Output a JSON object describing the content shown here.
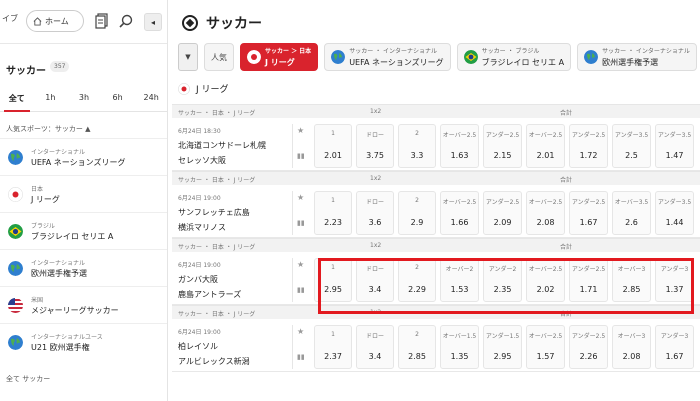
{
  "topbar": {
    "ibu_label": "イブ",
    "home_label": "ホーム",
    "collapse_glyph": "◂"
  },
  "sidebar": {
    "title": "サッカー",
    "count": "357",
    "time_tabs": [
      "全て",
      "1h",
      "3h",
      "6h",
      "24h"
    ],
    "popular_heading": "人気スポーツ：サッカー ▲",
    "items": [
      {
        "sub": "インターナショナル",
        "name": "UEFA ネーションズリーグ",
        "flag": "globe"
      },
      {
        "sub": "日本",
        "name": "J リーグ",
        "flag": "japan"
      },
      {
        "sub": "ブラジル",
        "name": "ブラジレイロ セリエ A",
        "flag": "brazil"
      },
      {
        "sub": "インターナショナル",
        "name": "欧州選手権予選",
        "flag": "globe"
      },
      {
        "sub": "米国",
        "name": "メジャーリーグサッカー",
        "flag": "usa"
      },
      {
        "sub": "インターナショナルユース",
        "name": "U21 欧州選手権",
        "flag": "globe"
      }
    ],
    "all_label": "全て サッカー"
  },
  "main": {
    "title": "サッカー",
    "chips": [
      {
        "plain": "人気"
      },
      {
        "sub": "サッカー ＞ 日本",
        "name": "J リーグ",
        "active": true,
        "flag": "japan"
      },
      {
        "sub": "サッカー ・ インターナショナル",
        "name": "UEFA ネーションズリーグ",
        "flag": "globe"
      },
      {
        "sub": "サッカー ・ ブラジル",
        "name": "ブラジレイロ セリエ A",
        "flag": "brazil"
      },
      {
        "sub": "サッカー ・ インターナショナル",
        "name": "欧州選手権予選",
        "flag": "globe"
      }
    ],
    "league_label": "J リーグ",
    "group_header": {
      "league": "サッカー ・ 日本 ・ J リーグ",
      "col_1x2": "1x2",
      "col_total": "合計"
    },
    "matches": [
      {
        "date": "6月24日 18:30",
        "home": "北海道コンサドーレ札幌",
        "away": "セレッソ大阪",
        "odds": [
          {
            "label": "1",
            "value": "2.01"
          },
          {
            "label": "ドロー",
            "value": "3.75"
          },
          {
            "label": "2",
            "value": "3.3"
          },
          {
            "label": "オーバー2.5",
            "value": "1.63"
          },
          {
            "label": "アンダー2.5",
            "value": "2.15"
          },
          {
            "label": "オーバー2.5",
            "value": "2.01"
          },
          {
            "label": "アンダー2.5",
            "value": "1.72"
          },
          {
            "label": "アンダー3.5",
            "value": "2.5"
          },
          {
            "label": "アンダー3.5",
            "value": "1.47"
          }
        ]
      },
      {
        "date": "6月24日 19:00",
        "home": "サンフレッチェ広島",
        "away": "横浜マリノス",
        "odds": [
          {
            "label": "1",
            "value": "2.23"
          },
          {
            "label": "ドロー",
            "value": "3.6"
          },
          {
            "label": "2",
            "value": "2.9"
          },
          {
            "label": "オーバー2.5",
            "value": "1.66"
          },
          {
            "label": "アンダー2.5",
            "value": "2.09"
          },
          {
            "label": "オーバー2.5",
            "value": "2.08"
          },
          {
            "label": "アンダー2.5",
            "value": "1.67"
          },
          {
            "label": "オーバー3.5",
            "value": "2.6"
          },
          {
            "label": "アンダー3.5",
            "value": "1.44"
          }
        ]
      },
      {
        "date": "6月24日 19:00",
        "home": "ガンバ大阪",
        "away": "鹿島アントラーズ",
        "odds": [
          {
            "label": "1",
            "value": "2.95"
          },
          {
            "label": "ドロー",
            "value": "3.4"
          },
          {
            "label": "2",
            "value": "2.29"
          },
          {
            "label": "オーバー2",
            "value": "1.53"
          },
          {
            "label": "アンダー2",
            "value": "2.35"
          },
          {
            "label": "オーバー2.5",
            "value": "2.02"
          },
          {
            "label": "アンダー2.5",
            "value": "1.71"
          },
          {
            "label": "オーバー3",
            "value": "2.85"
          },
          {
            "label": "アンダー3",
            "value": "1.37"
          }
        ]
      },
      {
        "date": "6月24日 19:00",
        "home": "柏レイソル",
        "away": "アルビレックス新潟",
        "odds": [
          {
            "label": "1",
            "value": "2.37"
          },
          {
            "label": "ドロー",
            "value": "3.4"
          },
          {
            "label": "2",
            "value": "2.85"
          },
          {
            "label": "オーバー1.5",
            "value": "1.35"
          },
          {
            "label": "アンダー1.5",
            "value": "2.95"
          },
          {
            "label": "オーバー2.5",
            "value": "1.57"
          },
          {
            "label": "アンダー2.5",
            "value": "2.26"
          },
          {
            "label": "オーバー3",
            "value": "2.08"
          },
          {
            "label": "アンダー3",
            "value": "1.67"
          }
        ]
      }
    ]
  },
  "colors": {
    "accent": "#d9232d",
    "highlight_box": "#e2191f"
  }
}
